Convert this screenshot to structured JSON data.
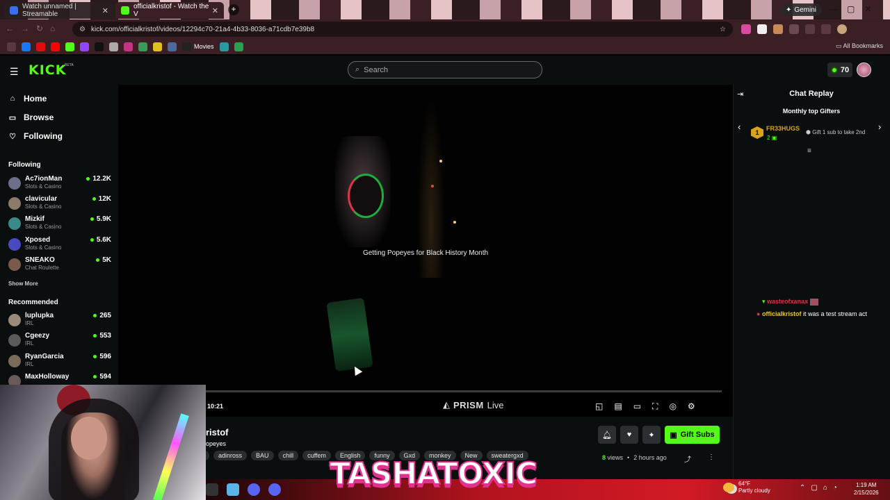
{
  "browser": {
    "tabs": [
      {
        "title": "Watch unnamed | Streamable",
        "fav_color": "#3a6ef0"
      },
      {
        "title": "officialkristof - Watch the V",
        "fav_color": "#53fc18"
      }
    ],
    "gemini_label": "Gemini",
    "url": "kick.com/officialkristof/videos/12294c70-21a4-4b33-8036-a71cdb7e39b8",
    "bookmarks_movies": "Movies",
    "all_bookmarks": "All Bookmarks"
  },
  "kick": {
    "logo": "KICK",
    "logo_badge": "BETA",
    "search_placeholder": "Search",
    "points": "70",
    "nav": {
      "home": "Home",
      "browse": "Browse",
      "following": "Following"
    },
    "following_header": "Following",
    "following": [
      {
        "name": "Ac7ionMan",
        "category": "Slots & Casino",
        "viewers": "12.2K",
        "avatar": "#6b6f8a"
      },
      {
        "name": "clavicular",
        "category": "Slots & Casino",
        "viewers": "12K",
        "avatar": "#8c7a6a"
      },
      {
        "name": "Mizkif",
        "category": "Slots & Casino",
        "viewers": "5.9K",
        "avatar": "#3a8a8a"
      },
      {
        "name": "Xposed",
        "category": "Slots & Casino",
        "viewers": "5.6K",
        "avatar": "#4a4ac0"
      },
      {
        "name": "SNEAKO",
        "category": "Chat Roulette",
        "viewers": "5K",
        "avatar": "#7a5a4a"
      }
    ],
    "show_more": "Show More",
    "recommended_header": "Recommended",
    "recommended": [
      {
        "name": "luplupka",
        "category": "IRL",
        "viewers": "265",
        "avatar": "#9a8a7a"
      },
      {
        "name": "Cgeezy",
        "category": "IRL",
        "viewers": "553",
        "avatar": "#5a5a5a"
      },
      {
        "name": "RyanGarcia",
        "category": "IRL",
        "viewers": "596",
        "avatar": "#7a6a5a"
      },
      {
        "name": "MaxHolloway",
        "category": "",
        "viewers": "594",
        "avatar": "#6a5a5a"
      }
    ],
    "video": {
      "caption": "Getting Popeyes for Black History Month",
      "time": "10:21",
      "prism_bold": "PRISM",
      "prism_rest": "Live"
    },
    "stream": {
      "title_fragment": "ristof",
      "subtitle_fragment": "opeyes",
      "tags": [
        "n",
        "adinross",
        "BAU",
        "chill",
        "cuffem",
        "English",
        "funny",
        "Gxd",
        "monkey",
        "New",
        "sweatergxd"
      ],
      "views_count": "8",
      "views_label": "views",
      "ago": "2 hours ago",
      "gift_subs": "Gift Subs"
    },
    "chat": {
      "title": "Chat Replay",
      "gifters_title": "Monthly top Gifters",
      "gifter_rank": "1",
      "gifter_name": "FR33HUGS",
      "gifter_count": "2",
      "gifter_cta": "Gift 1 sub to take 2nd",
      "messages": [
        {
          "user": "wasteofxanax",
          "user_color": "#e0334a",
          "text": ""
        },
        {
          "user": "officialkristof",
          "user_color": "#f0c043",
          "text": "it was a test stream act"
        }
      ]
    }
  },
  "overlay": {
    "watermark": "TASHATOXIC",
    "weather_temp": "64°F",
    "weather_desc": "Partly cloudy",
    "clock_time": "1:19 AM",
    "clock_date": "2/15/2026"
  }
}
